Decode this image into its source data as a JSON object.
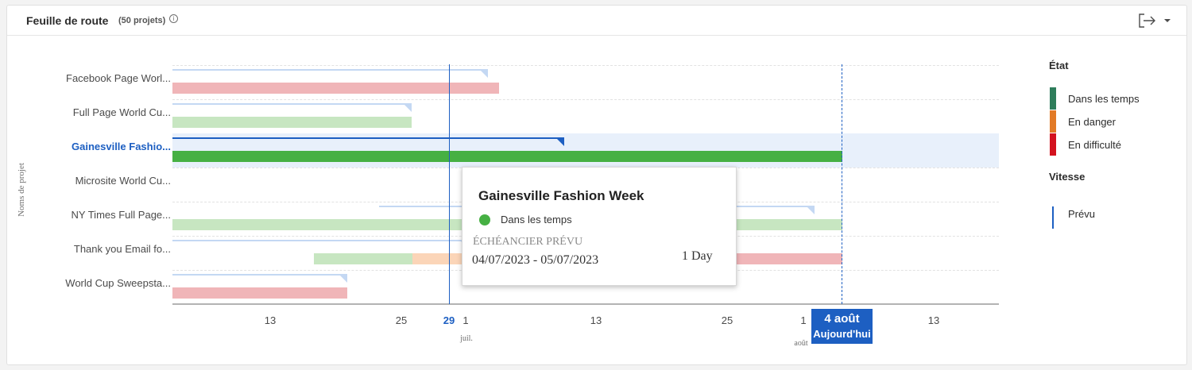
{
  "header": {
    "title": "Feuille de route",
    "count": "(50 projets)",
    "info_icon": "info-icon",
    "export_icon": "export-icon",
    "dropdown_icon": "chevron-down-icon"
  },
  "chart": {
    "y_axis_title": "Noms de projet",
    "rows": [
      {
        "label": "Facebook Page Worl...",
        "active": false
      },
      {
        "label": "Full Page World Cu...",
        "active": false
      },
      {
        "label": "Gainesville Fashio...",
        "active": true
      },
      {
        "label": "Microsite World Cu...",
        "active": false
      },
      {
        "label": "NY Times Full Page...",
        "active": false
      },
      {
        "label": "Thank you Email fo...",
        "active": false
      },
      {
        "label": "World Cup Sweepsta...",
        "active": false
      }
    ],
    "ticks": [
      {
        "label": "13",
        "strong": false
      },
      {
        "label": "25",
        "strong": false
      },
      {
        "label": "29",
        "strong": true
      },
      {
        "label": "1",
        "strong": false
      },
      {
        "label": "13",
        "strong": false
      },
      {
        "label": "25",
        "strong": false
      },
      {
        "label": "1",
        "strong": false
      },
      {
        "label": "13",
        "strong": false
      }
    ],
    "months": [
      "juil.",
      "août"
    ],
    "today": {
      "date": "4 août",
      "label": "Aujourd'hui"
    }
  },
  "tooltip": {
    "title": "Gainesville Fashion Week",
    "status": "Dans les temps",
    "status_color": "#46b043",
    "schedule_label": "ÉCHÉANCIER PRÉVU",
    "dates": "04/07/2023 - 05/07/2023",
    "duration": "1 Day"
  },
  "legend": {
    "state_title": "État",
    "states": [
      {
        "label": "Dans les temps",
        "color": "#2e7d5b"
      },
      {
        "label": "En danger",
        "color": "#e27a26"
      },
      {
        "label": "En difficulté",
        "color": "#d3121f"
      }
    ],
    "speed_title": "Vitesse",
    "speed_items": [
      {
        "label": "Prévu",
        "color": "#1d5fc2"
      }
    ]
  },
  "colors": {
    "accent": "#1d5fc2",
    "on_time": "#46b043",
    "on_time_light": "#c7e6c1",
    "at_risk_light": "#fbd5b8",
    "in_trouble_light": "#f0b5b8",
    "planned_light": "#c4d8f3"
  }
}
